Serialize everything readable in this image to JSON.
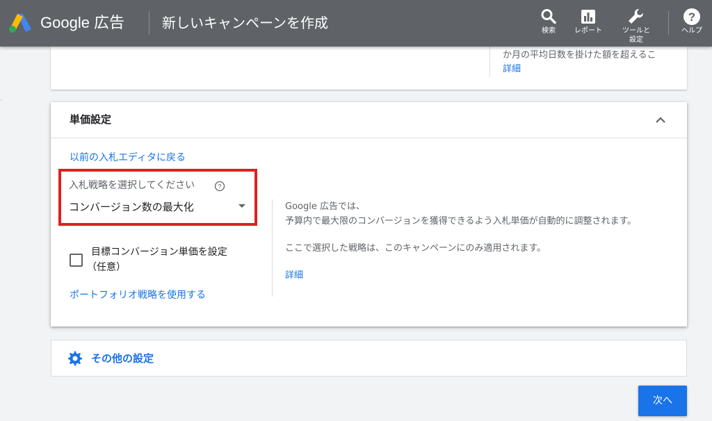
{
  "header": {
    "brand": "Google 広告",
    "page_title": "新しいキャンペーンを作成",
    "tools": [
      {
        "label": "検索",
        "icon": "search-icon"
      },
      {
        "label": "レポート",
        "icon": "bar-chart-icon"
      },
      {
        "label": "ツールと設定",
        "icon": "wrench-icon"
      },
      {
        "label": "ヘルプ",
        "icon": "help-circle-icon"
      }
    ]
  },
  "top_card": {
    "note": "か月の平均日数を掛けた額を超えるこ",
    "link": "詳細"
  },
  "bidding": {
    "title": "単価設定",
    "back_link": "以前の入札エディタに戻る",
    "strategy_label": "入札戦略を選択してください",
    "strategy_value": "コンバージョン数の最大化",
    "target_cpa_label_line1": "目標コンバージョン単価を設定",
    "target_cpa_label_line2": "（任意）",
    "portfolio_link": "ポートフォリオ戦略を使用する",
    "info_line1": "Google 広告では、",
    "info_line2": "予算内で最大限のコンバージョンを獲得できるよう入札単価が自動的に調整されます。",
    "info_line3": "ここで選択した戦略は、このキャンペーンにのみ適用されます。",
    "info_link": "詳細",
    "target_cpa_checked": false
  },
  "other_settings": {
    "label": "その他の設定",
    "icon": "gear-icon"
  },
  "footer": {
    "next_label": "次へ"
  },
  "colors": {
    "header_bg": "#5f6368",
    "link": "#1a73e8",
    "highlight_box": "#e02020",
    "primary_button": "#1a73e8"
  }
}
